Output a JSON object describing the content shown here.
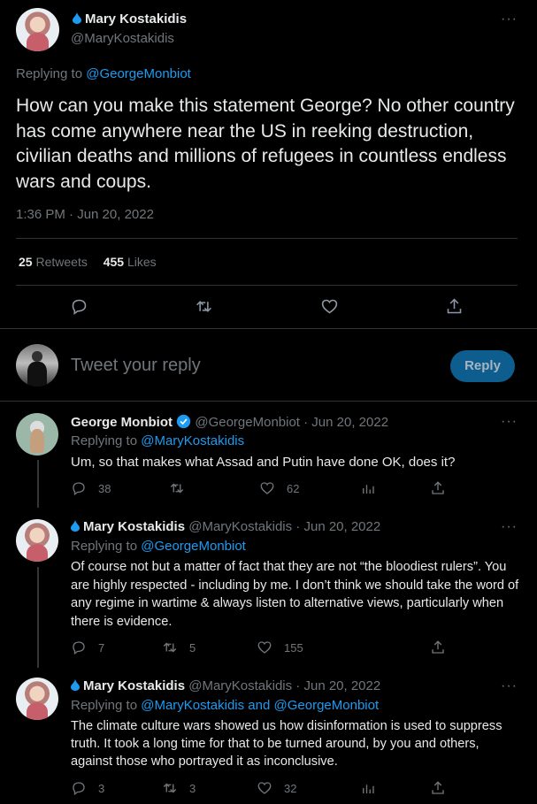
{
  "main_tweet": {
    "name": "Mary Kostakidis",
    "handle": "@MaryKostakidis",
    "replying_prefix": "Replying to",
    "replying_to": "@GeorgeMonbiot",
    "text": "How can you make this statement George? No other country has come anywhere near the US in reeking destruction, civilian deaths and millions of refugees in countless endless wars and coups.",
    "timestamp": "1:36 PM · Jun 20, 2022",
    "retweets_count": "25",
    "retweets_label": "Retweets",
    "likes_count": "455",
    "likes_label": "Likes"
  },
  "composer": {
    "placeholder": "Tweet your reply",
    "button": "Reply"
  },
  "replies": [
    {
      "name": "George Monbiot",
      "meta": "@GeorgeMonbiot · Jun 20, 2022",
      "replying_prefix": "Replying to",
      "replying_to": "@MaryKostakidis",
      "text": "Um, so that makes what Assad and Putin have done OK, does it?",
      "replies": "38",
      "retweets": "",
      "likes": "62"
    },
    {
      "name": "Mary Kostakidis",
      "meta": "@MaryKostakidis · Jun 20, 2022",
      "replying_prefix": "Replying to",
      "replying_to": "@GeorgeMonbiot",
      "text": "Of course not but a matter of fact that they are not “the bloodiest rulers”. You are highly respected - including by me. I don’t think we should take the word of any regime in wartime & always listen to alternative views, particularly when there is evidence.",
      "replies": "7",
      "retweets": "5",
      "likes": "155"
    },
    {
      "name": "Mary Kostakidis",
      "meta": "@MaryKostakidis · Jun 20, 2022",
      "replying_prefix": "Replying to",
      "replying_to": "@MaryKostakidis and @GeorgeMonbiot",
      "text": "The climate culture wars showed us how disinformation is used to suppress truth. It took a long time for that to be turned around, by you and others, against those who portrayed it as inconclusive.",
      "replies": "3",
      "retweets": "3",
      "likes": "32"
    }
  ],
  "icons": {
    "reply": "reply-icon",
    "retweet": "retweet-icon",
    "like": "heart-icon",
    "analytics": "analytics-icon",
    "share": "share-icon",
    "more": "more-icon",
    "verified": "verified-badge-icon",
    "drop": "water-drop-icon"
  },
  "colors": {
    "background": "#000000",
    "text": "#e7e9ea",
    "muted": "#71767b",
    "accent": "#1d9bf0",
    "reply_button": "#0d5d8f"
  }
}
